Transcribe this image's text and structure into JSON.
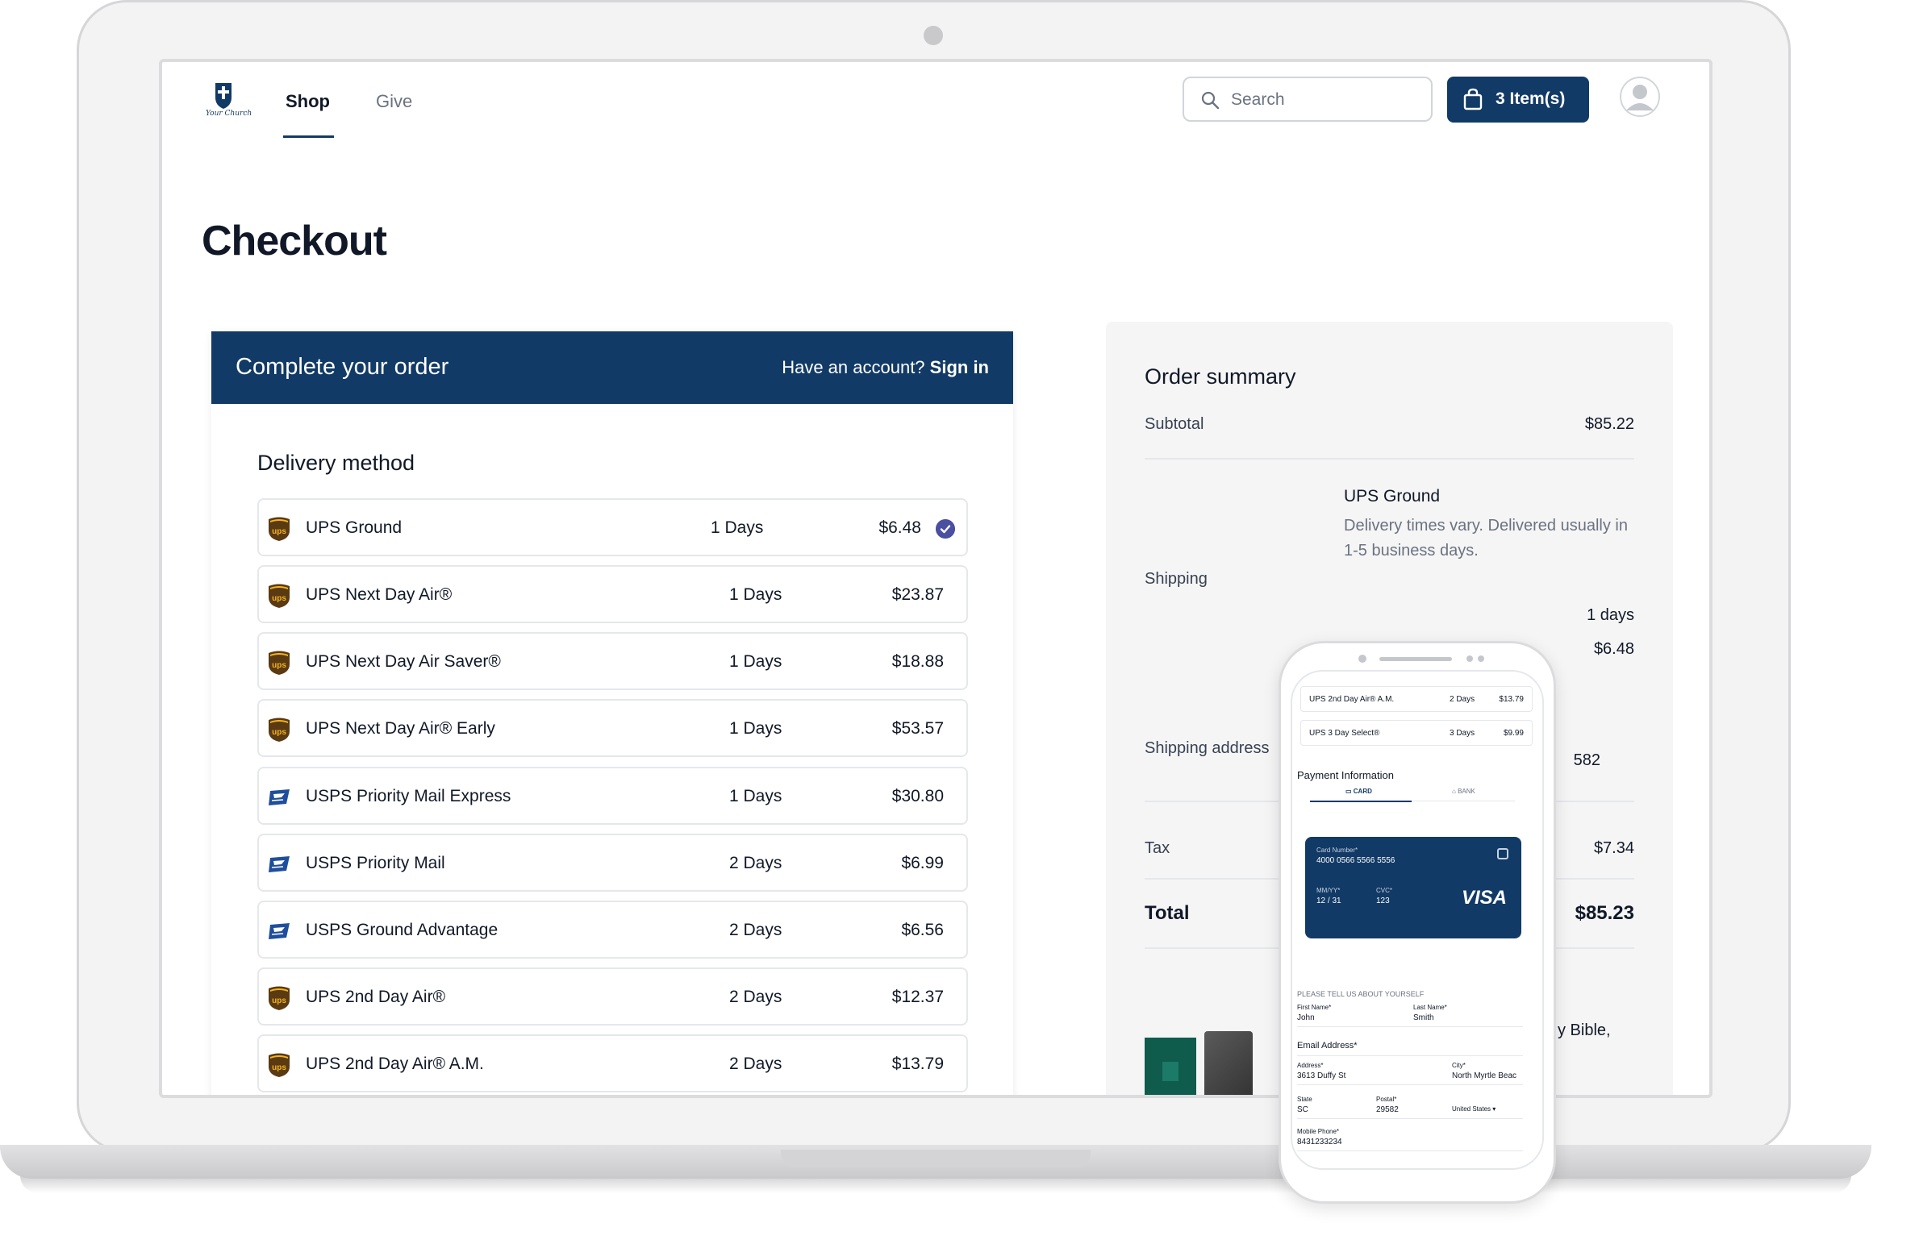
{
  "nav": {
    "logo_text": "Your Church",
    "links": [
      "Shop",
      "Give"
    ],
    "search_placeholder": "Search",
    "cart_label": "3 Item(s)"
  },
  "page_title": "Checkout",
  "order_card": {
    "header_title": "Complete your order",
    "account_prompt": "Have an account?",
    "sign_in": "Sign in",
    "delivery_title": "Delivery method",
    "options": [
      {
        "carrier": "ups",
        "name": "UPS Ground",
        "days": "1 Days",
        "price": "$6.48",
        "selected": true
      },
      {
        "carrier": "ups",
        "name": "UPS Next Day Air®",
        "days": "1 Days",
        "price": "$23.87"
      },
      {
        "carrier": "ups",
        "name": "UPS Next Day Air Saver®",
        "days": "1 Days",
        "price": "$18.88"
      },
      {
        "carrier": "ups",
        "name": "UPS Next Day Air® Early",
        "days": "1 Days",
        "price": "$53.57"
      },
      {
        "carrier": "usps",
        "name": "USPS Priority Mail Express",
        "days": "1 Days",
        "price": "$30.80"
      },
      {
        "carrier": "usps",
        "name": "USPS Priority Mail",
        "days": "2 Days",
        "price": "$6.99"
      },
      {
        "carrier": "usps",
        "name": "USPS Ground Advantage",
        "days": "2 Days",
        "price": "$6.56"
      },
      {
        "carrier": "ups",
        "name": "UPS 2nd Day Air®",
        "days": "2 Days",
        "price": "$12.37"
      },
      {
        "carrier": "ups",
        "name": "UPS 2nd Day Air® A.M.",
        "days": "2 Days",
        "price": "$13.79"
      }
    ]
  },
  "summary": {
    "title": "Order summary",
    "subtotal_label": "Subtotal",
    "subtotal_value": "$85.22",
    "shipping_label": "Shipping",
    "shipping_name": "UPS Ground",
    "shipping_desc": "Delivery times vary. Delivered usually in 1-5 business days.",
    "shipping_days": "1 days",
    "shipping_price": "$6.48",
    "address_label": "Shipping address",
    "address_fragment": "582",
    "tax_label": "Tax",
    "tax_value": "$7.34",
    "total_label": "Total",
    "total_value": "$85.23",
    "item_fragment": "y Bible,"
  },
  "phone": {
    "rows": [
      {
        "name": "UPS 2nd Day Air® A.M.",
        "days": "2 Days",
        "price": "$13.79"
      },
      {
        "name": "UPS 3 Day Select®",
        "days": "3 Days",
        "price": "$9.99"
      }
    ],
    "payment_title": "Payment Information",
    "tab_card": "CARD",
    "tab_bank": "BANK",
    "card": {
      "number_label": "Card Number*",
      "number": "4000 0566 5566 5556",
      "exp_label": "MM/YY*",
      "exp": "12 / 31",
      "cvc_label": "CVC*",
      "cvc": "123",
      "brand": "VISA"
    },
    "about_title": "PLEASE TELL US ABOUT YOURSELF",
    "first_name_label": "First Name*",
    "first_name": "John",
    "last_name_label": "Last Name*",
    "last_name": "Smith",
    "email_label": "Email Address*",
    "address_label": "Address*",
    "address": "3613 Duffy St",
    "city_label": "City*",
    "city": "North Myrtle Beac",
    "state_label": "State",
    "state": "SC",
    "postal_label": "Postal*",
    "postal": "29582",
    "country": "United States",
    "phone_label": "Mobile Phone*",
    "phone_value": "8431233234"
  },
  "colors": {
    "brand_navy": "#123a66",
    "ups_brown": "#5a3a12",
    "ups_gold": "#f5b41b",
    "check": "#4a4fa1"
  }
}
